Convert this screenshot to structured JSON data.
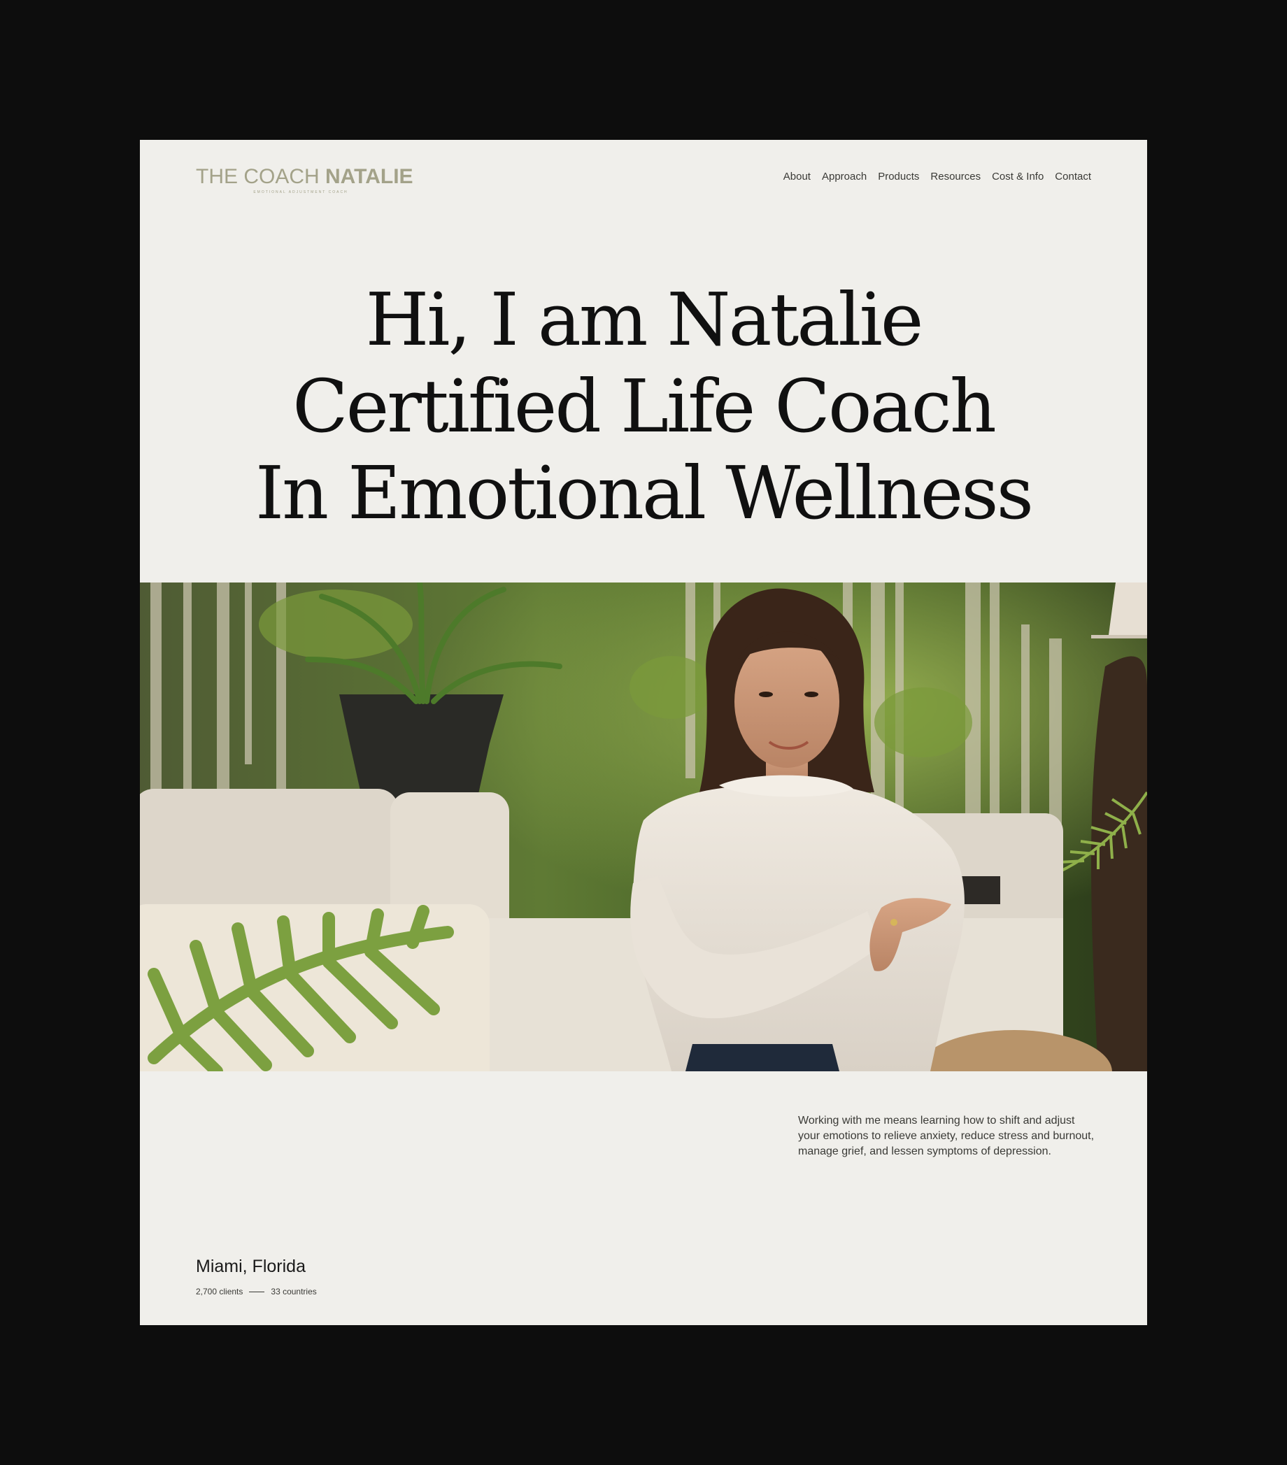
{
  "logo": {
    "name_light": "THE COACH ",
    "name_bold": "NATALIE",
    "tagline": "EMOTIONAL ADJUSTMENT COACH",
    "color": "#a3a289"
  },
  "nav": {
    "items": [
      "About",
      "Approach",
      "Products",
      "Resources",
      "Cost & Info",
      "Contact"
    ]
  },
  "hero": {
    "lines": [
      "Hi, I am Natalie",
      "Certified Life Coach",
      "In Emotional Wellness"
    ]
  },
  "photo": {
    "alt": "Portrait of a woman in a white sweater seated on a cream sofa surrounded by tropical plants"
  },
  "intro": {
    "text": "Working with me means learning how to shift and adjust your emotions to relieve anxiety, reduce stress and burnout, manage grief, and lessen symptoms of depression."
  },
  "location": {
    "city": "Miami, Florida",
    "clients": "2,700 clients",
    "countries": "33 countries"
  },
  "colors": {
    "backdrop": "#0d0d0d",
    "page": "#f0efeb",
    "text": "#101010"
  }
}
